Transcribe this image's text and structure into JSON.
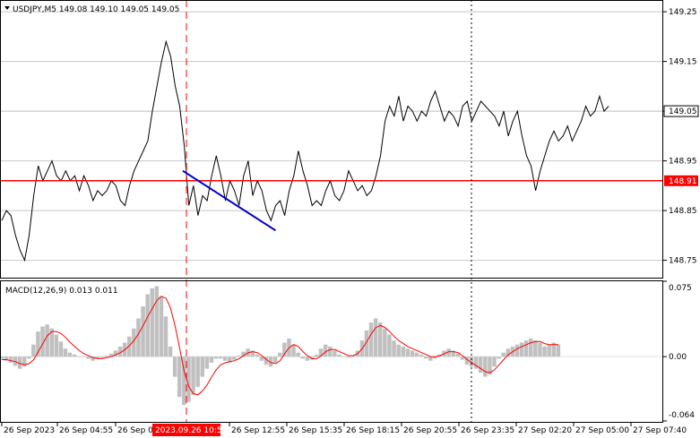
{
  "colors": {
    "background": "#ffffff",
    "price_line": "#000000",
    "level_line": "#ff0000",
    "level_label_bg": "#ff0000",
    "current_price_bg": "#ffffff",
    "trend_line": "#0000cc",
    "macd_histogram": "#c0c0c0",
    "macd_signal": "#ff0000",
    "grid": "#c8c8c8",
    "frame": "#000000",
    "session_marker": "#ff0000",
    "cursor_line": "#000000",
    "time_label_bg": "#ff0000"
  },
  "header": {
    "title": "USDJPY,M5  149.08 149.10 149.05 149.05",
    "menu_icon": "triangle-down-icon"
  },
  "chart_data": [
    {
      "type": "line",
      "panel": "price",
      "symbol": "USDJPY",
      "timeframe": "M5",
      "ohlc": {
        "open": 149.08,
        "high": 149.1,
        "low": 149.05,
        "close": 149.05
      },
      "ylim": [
        148.715,
        149.27
      ],
      "y_ticks": [
        "149.25",
        "149.15",
        "149.05",
        "148.95",
        "148.85",
        "148.75"
      ],
      "level_line": {
        "value": 148.91,
        "label": "148.91"
      },
      "current_price": {
        "value": 149.05,
        "label": "149.05"
      },
      "trend_line": {
        "from": {
          "x": 119,
          "y": 148.93
        },
        "to": {
          "x": 180,
          "y": 148.81
        }
      },
      "x": [
        0,
        3,
        6,
        9,
        12,
        15,
        18,
        21,
        24,
        27,
        30,
        33,
        36,
        39,
        42,
        45,
        48,
        51,
        54,
        57,
        60,
        63,
        66,
        69,
        72,
        75,
        78,
        81,
        84,
        87,
        90,
        93,
        96,
        99,
        102,
        105,
        108,
        111,
        114,
        117,
        120,
        123,
        126,
        129,
        132,
        135,
        138,
        141,
        144,
        147,
        150,
        153,
        156,
        159,
        162,
        165,
        168,
        171,
        174,
        177,
        180,
        183,
        186,
        189,
        192,
        195,
        198,
        201,
        204,
        207,
        210,
        213,
        216,
        219,
        222,
        225,
        228,
        231,
        234,
        237,
        240,
        243,
        246,
        249,
        252,
        255,
        258,
        261,
        264,
        267,
        270,
        273,
        276,
        279,
        282,
        285,
        288,
        291,
        294,
        297,
        300,
        303,
        306,
        309,
        312,
        315,
        318,
        321,
        324,
        327,
        330,
        333,
        336,
        339,
        342,
        345,
        348,
        351,
        354,
        357,
        360,
        363,
        366,
        369,
        372,
        375,
        378,
        381,
        384,
        387,
        390,
        393,
        396,
        399,
        402,
        405,
        408,
        411,
        414,
        417,
        420,
        423,
        426,
        429
      ],
      "values": [
        148.83,
        148.85,
        148.84,
        148.8,
        148.77,
        148.75,
        148.8,
        148.88,
        148.94,
        148.91,
        148.93,
        148.95,
        148.92,
        148.91,
        148.93,
        148.91,
        148.92,
        148.89,
        148.92,
        148.9,
        148.87,
        148.89,
        148.88,
        148.89,
        148.91,
        148.9,
        148.87,
        148.86,
        148.9,
        148.93,
        148.95,
        148.97,
        148.99,
        149.05,
        149.1,
        149.15,
        149.19,
        149.16,
        149.1,
        149.06,
        148.98,
        148.86,
        148.9,
        148.84,
        148.88,
        148.87,
        148.92,
        148.96,
        148.92,
        148.87,
        148.91,
        148.89,
        148.86,
        148.92,
        148.95,
        148.88,
        148.91,
        148.89,
        148.85,
        148.83,
        148.86,
        148.87,
        148.84,
        148.89,
        148.92,
        148.97,
        148.93,
        148.9,
        148.86,
        148.87,
        148.86,
        148.89,
        148.91,
        148.88,
        148.87,
        148.89,
        148.93,
        148.91,
        148.89,
        148.9,
        148.88,
        148.89,
        148.92,
        148.96,
        149.03,
        149.06,
        149.04,
        149.08,
        149.03,
        149.06,
        149.05,
        149.03,
        149.05,
        149.04,
        149.07,
        149.09,
        149.06,
        149.03,
        149.05,
        149.04,
        149.02,
        149.06,
        149.07,
        149.03,
        149.05,
        149.07,
        149.06,
        149.05,
        149.04,
        149.02,
        149.05,
        149.0,
        149.03,
        149.05,
        149.0,
        148.96,
        148.94,
        148.89,
        148.93,
        148.96,
        148.99,
        149.01,
        148.99,
        149.0,
        149.02,
        148.99,
        149.01,
        149.03,
        149.06,
        149.04,
        149.05,
        149.08,
        149.05,
        149.06
      ]
    },
    {
      "type": "area",
      "panel": "macd",
      "label": "MACD(12,26,9) 0.013 0.011",
      "ylim": [
        -0.064,
        0.075
      ],
      "y_ticks": [
        "0.075",
        "0.00",
        "-0.064"
      ],
      "x": [
        0,
        3,
        6,
        9,
        12,
        15,
        18,
        21,
        24,
        27,
        30,
        33,
        36,
        39,
        42,
        45,
        48,
        51,
        54,
        57,
        60,
        63,
        66,
        69,
        72,
        75,
        78,
        81,
        84,
        87,
        90,
        93,
        96,
        99,
        102,
        105,
        108,
        111,
        114,
        117,
        120,
        123,
        126,
        129,
        132,
        135,
        138,
        141,
        144,
        147,
        150,
        153,
        156,
        159,
        162,
        165,
        168,
        171,
        174,
        177,
        180,
        183,
        186,
        189,
        192,
        195,
        198,
        201,
        204,
        207,
        210,
        213,
        216,
        219,
        222,
        225,
        228,
        231,
        234,
        237,
        240,
        243,
        246,
        249,
        252,
        255,
        258,
        261,
        264,
        267,
        270,
        273,
        276,
        279,
        282,
        285,
        288,
        291,
        294,
        297,
        300,
        303,
        306,
        309,
        312,
        315,
        318,
        321,
        324,
        327,
        330,
        333,
        336,
        339,
        342,
        345,
        348,
        351,
        354,
        357,
        360,
        363,
        366,
        369,
        372,
        375,
        378,
        381,
        384,
        387,
        390,
        393,
        396,
        399,
        402,
        405,
        408,
        411,
        414,
        417,
        420,
        423,
        426,
        429
      ],
      "histogram": [
        -0.002,
        -0.004,
        -0.006,
        -0.009,
        -0.012,
        -0.01,
        -0.002,
        0.012,
        0.025,
        0.03,
        0.032,
        0.028,
        0.022,
        0.015,
        0.008,
        0.004,
        0.002,
        0.0,
        0.0,
        -0.002,
        -0.004,
        -0.002,
        -0.001,
        0.001,
        0.003,
        0.006,
        0.01,
        0.014,
        0.02,
        0.028,
        0.038,
        0.05,
        0.062,
        0.068,
        0.07,
        0.06,
        0.04,
        0.01,
        -0.02,
        -0.04,
        -0.048,
        -0.045,
        -0.038,
        -0.03,
        -0.02,
        -0.012,
        -0.006,
        -0.002,
        -0.002,
        -0.004,
        -0.006,
        -0.003,
        0.001,
        0.005,
        0.008,
        0.006,
        0.002,
        -0.004,
        -0.008,
        -0.01,
        -0.006,
        0.004,
        0.014,
        0.018,
        0.012,
        0.004,
        -0.002,
        -0.004,
        -0.003,
        0.002,
        0.008,
        0.012,
        0.01,
        0.006,
        0.002,
        0.0,
        -0.001,
        0.001,
        0.006,
        0.016,
        0.026,
        0.034,
        0.038,
        0.034,
        0.028,
        0.022,
        0.016,
        0.012,
        0.01,
        0.008,
        0.006,
        0.004,
        0.002,
        -0.002,
        -0.004,
        -0.002,
        0.002,
        0.006,
        0.008,
        0.006,
        0.003,
        -0.003,
        -0.008,
        -0.01,
        -0.012,
        -0.016,
        -0.02,
        -0.018,
        -0.01,
        -0.002,
        0.004,
        0.008,
        0.01,
        0.012,
        0.014,
        0.016,
        0.018,
        0.016,
        0.014,
        0.01,
        0.012,
        0.014,
        0.012
      ],
      "signal": [
        -0.003,
        -0.003,
        -0.004,
        -0.005,
        -0.007,
        -0.008,
        -0.007,
        -0.003,
        0.005,
        0.013,
        0.021,
        0.025,
        0.025,
        0.023,
        0.019,
        0.014,
        0.01,
        0.006,
        0.003,
        0.001,
        -0.001,
        -0.002,
        -0.002,
        -0.001,
        0.0,
        0.002,
        0.004,
        0.007,
        0.011,
        0.016,
        0.023,
        0.031,
        0.04,
        0.048,
        0.056,
        0.06,
        0.058,
        0.048,
        0.03,
        0.008,
        -0.015,
        -0.03,
        -0.037,
        -0.038,
        -0.034,
        -0.028,
        -0.02,
        -0.013,
        -0.008,
        -0.006,
        -0.005,
        -0.004,
        -0.002,
        0.001,
        0.004,
        0.005,
        0.004,
        0.001,
        -0.003,
        -0.006,
        -0.007,
        -0.004,
        0.003,
        0.009,
        0.012,
        0.01,
        0.005,
        0.001,
        -0.002,
        -0.002,
        0.001,
        0.005,
        0.007,
        0.007,
        0.005,
        0.003,
        0.001,
        0.001,
        0.003,
        0.008,
        0.015,
        0.023,
        0.029,
        0.031,
        0.029,
        0.025,
        0.02,
        0.016,
        0.013,
        0.01,
        0.008,
        0.006,
        0.004,
        0.002,
        0.0,
        0.0,
        0.001,
        0.003,
        0.005,
        0.005,
        0.004,
        0.001,
        -0.003,
        -0.006,
        -0.009,
        -0.012,
        -0.015,
        -0.016,
        -0.013,
        -0.008,
        -0.003,
        0.002,
        0.005,
        0.008,
        0.01,
        0.012,
        0.014,
        0.015,
        0.015,
        0.013,
        0.012,
        0.012,
        0.012
      ]
    }
  ],
  "x_axis": {
    "labels": [
      "26 Sep 2023",
      "26 Sep 04:55",
      "26 Sep 0",
      "26 Sep 12:55",
      "26 Sep 15:35",
      "26 Sep 18:15",
      "26 Sep 20:55",
      "26 Sep 23:35",
      "27 Sep 02:20",
      "27 Sep 05:00",
      "27 Sep 07:40"
    ],
    "highlight_label": "2023.09.26 10:50"
  }
}
